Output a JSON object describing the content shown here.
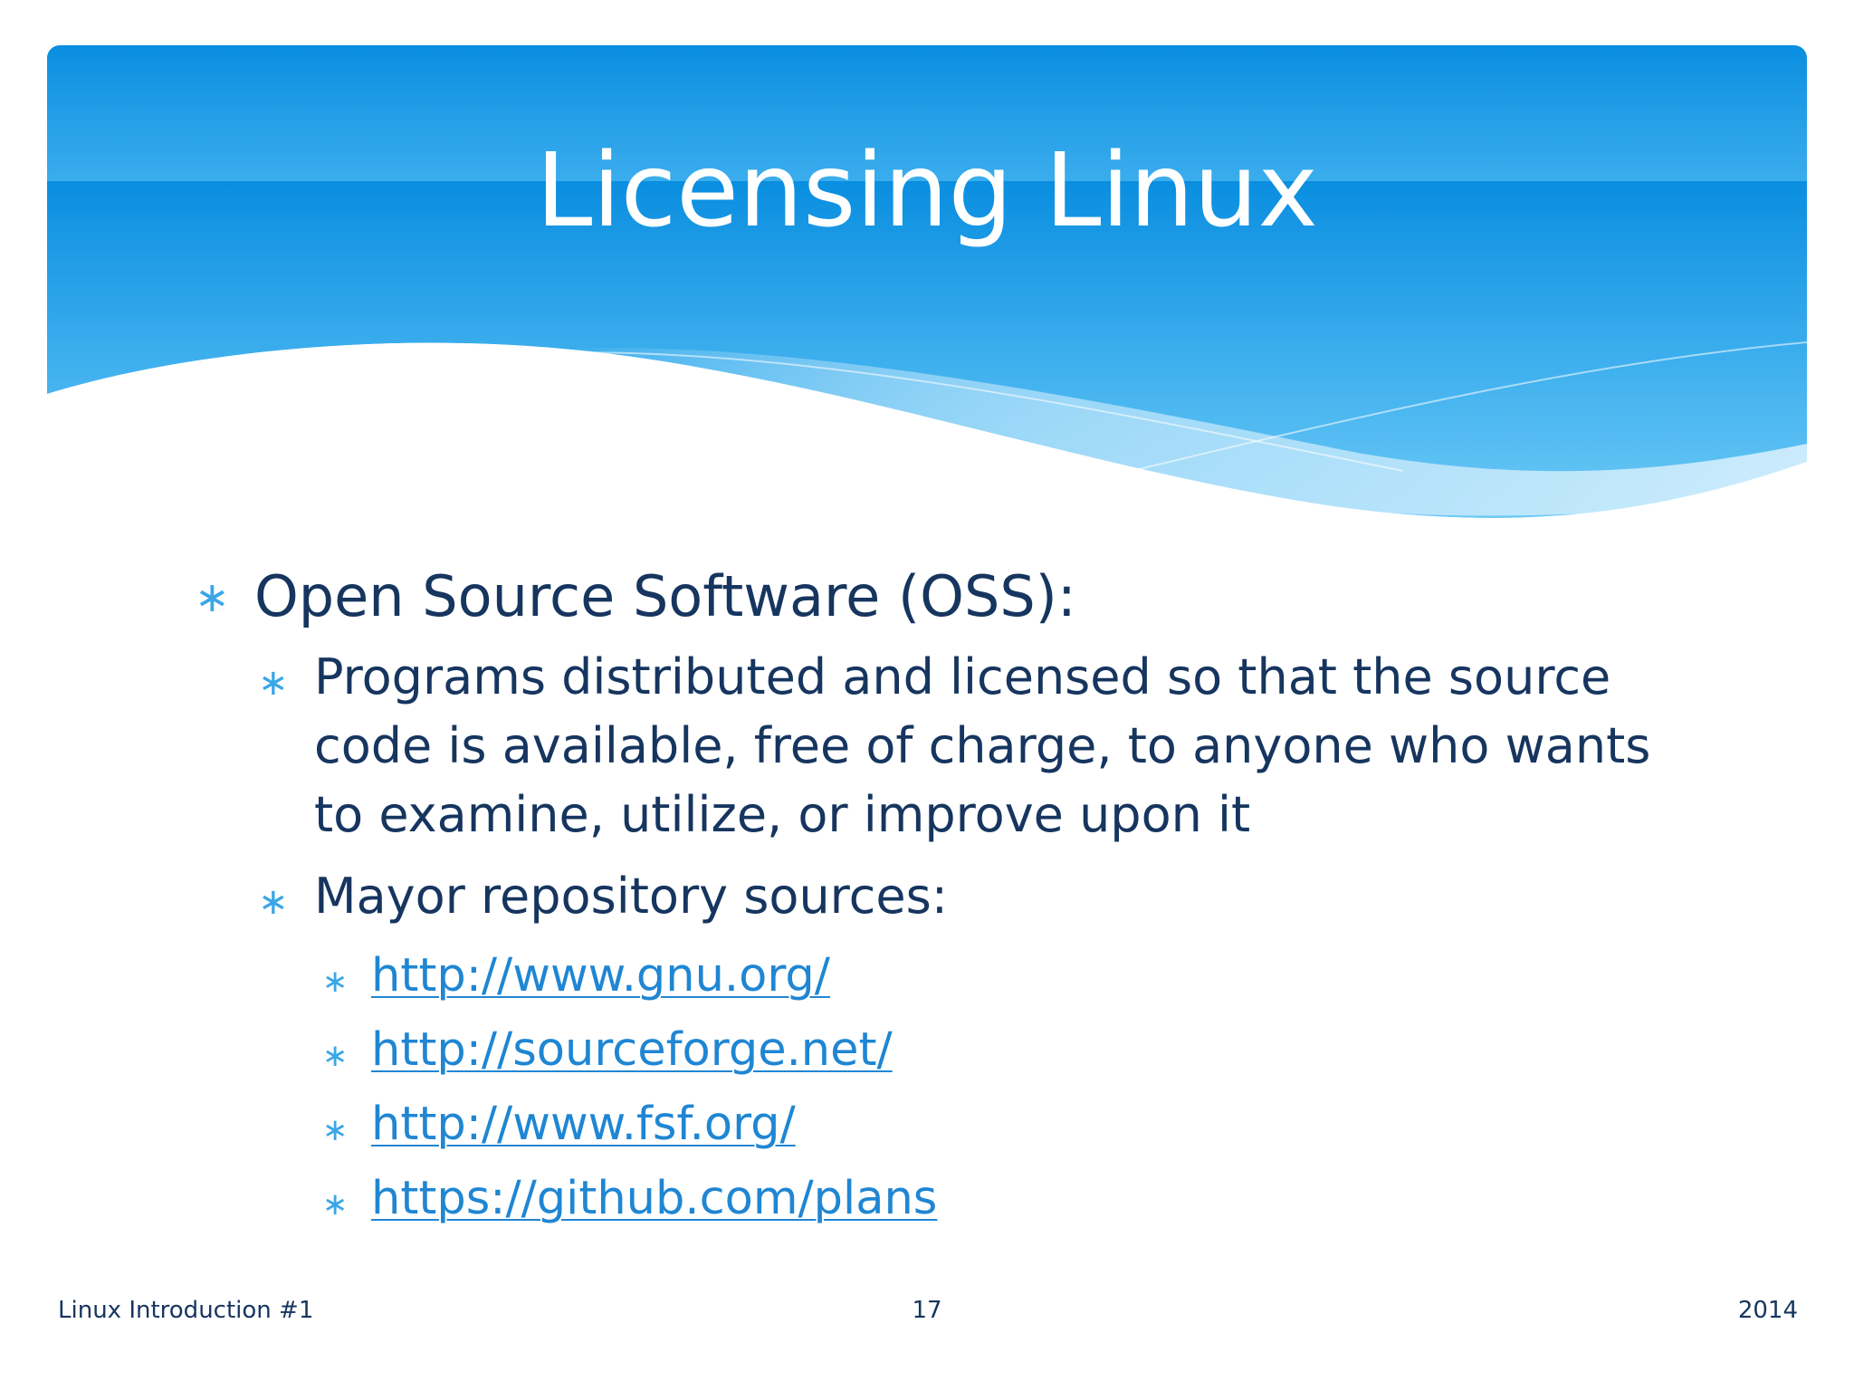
{
  "slide": {
    "title": "Licensing Linux",
    "bullets": [
      {
        "text": "Open Source Software (OSS):",
        "children": [
          {
            "text": "Programs distributed and licensed so that the source code is available, free of charge, to anyone who wants to examine, utilize, or improve upon it"
          },
          {
            "text": "Mayor repository sources:",
            "links": [
              "http://www.gnu.org/",
              "http://sourceforge.net/",
              "http://www.fsf.org/",
              "https://github.com/plans"
            ]
          }
        ]
      }
    ]
  },
  "footer": {
    "left": "Linux Introduction #1",
    "center": "17",
    "right": "2014"
  },
  "icons": {
    "bullet": "asterisk-bullet-icon"
  },
  "colors": {
    "header_top": "#0a8ee0",
    "header_bottom": "#5ec0f4",
    "text": "#16355f",
    "link": "#1f86d3",
    "bullet": "#3aa6e6"
  }
}
